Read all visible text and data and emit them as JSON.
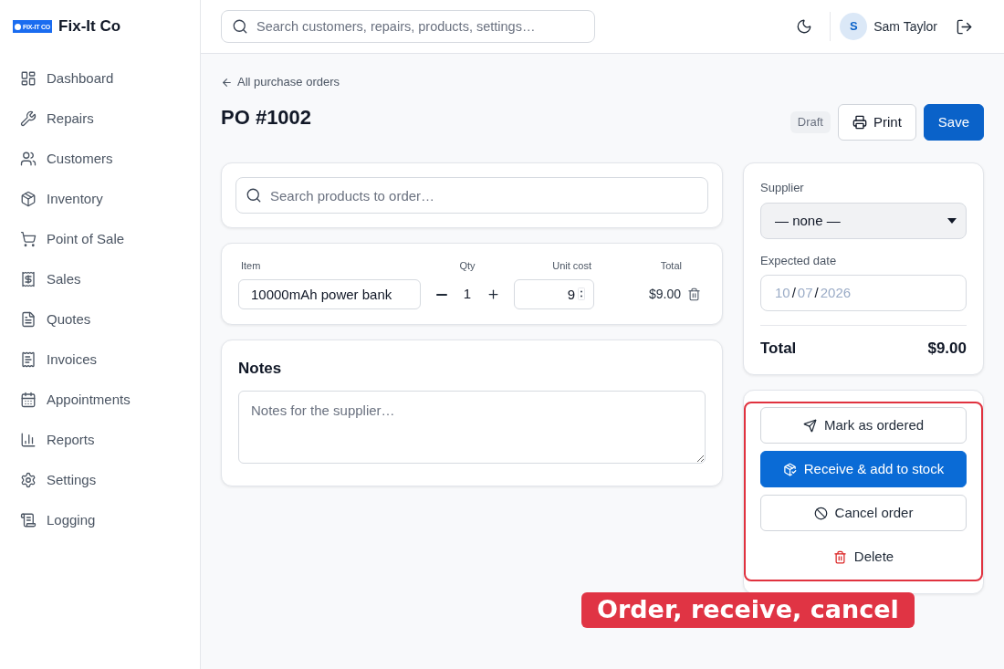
{
  "brand": {
    "logo_text": "FIX-IT CO",
    "name": "Fix-It Co"
  },
  "sidebar": {
    "items": [
      {
        "label": "Dashboard"
      },
      {
        "label": "Repairs"
      },
      {
        "label": "Customers"
      },
      {
        "label": "Inventory"
      },
      {
        "label": "Point of Sale"
      },
      {
        "label": "Sales"
      },
      {
        "label": "Quotes"
      },
      {
        "label": "Invoices"
      },
      {
        "label": "Appointments"
      },
      {
        "label": "Reports"
      },
      {
        "label": "Settings"
      },
      {
        "label": "Logging"
      }
    ]
  },
  "header": {
    "search": {
      "placeholder": "Search customers, repairs, products, settings…"
    },
    "user": {
      "initial": "S",
      "name": "Sam Taylor"
    }
  },
  "page": {
    "back_link": "All purchase orders",
    "title": "PO #1002",
    "status_badge": "Draft",
    "buttons": [
      {
        "label": "Print",
        "kind": "secondary"
      },
      {
        "label": "Save",
        "kind": "primary"
      }
    ]
  },
  "product_search": {
    "placeholder": "Search products to order…"
  },
  "line_items": {
    "columns": [
      "Item",
      "Qty",
      "Unit cost",
      "Total"
    ],
    "rows": [
      {
        "item": "10000mAh power bank",
        "qty": "1",
        "unit_cost": "9",
        "total": "$9.00"
      }
    ]
  },
  "notes": {
    "title": "Notes",
    "placeholder": "Notes for the supplier…"
  },
  "summary": {
    "supplier": {
      "label": "Supplier",
      "value": "— none —"
    },
    "expected_date": {
      "label": "Expected date",
      "segments": [
        {
          "text": "10",
          "kind": "part"
        },
        {
          "text": "/",
          "kind": "separator"
        },
        {
          "text": "07",
          "kind": "part"
        },
        {
          "text": "/",
          "kind": "separator"
        },
        {
          "text": "2026",
          "kind": "part"
        }
      ]
    },
    "total": {
      "label": "Total",
      "value": "$9.00"
    }
  },
  "actions": [
    {
      "label": "Mark as ordered",
      "kind": "outline"
    },
    {
      "label": "Receive & add to stock",
      "kind": "primary"
    },
    {
      "label": "Cancel order",
      "kind": "outline"
    },
    {
      "label": "Delete",
      "kind": "danger"
    }
  ],
  "annotation": {
    "highlighted": true,
    "text": "Order, receive, cancel"
  }
}
